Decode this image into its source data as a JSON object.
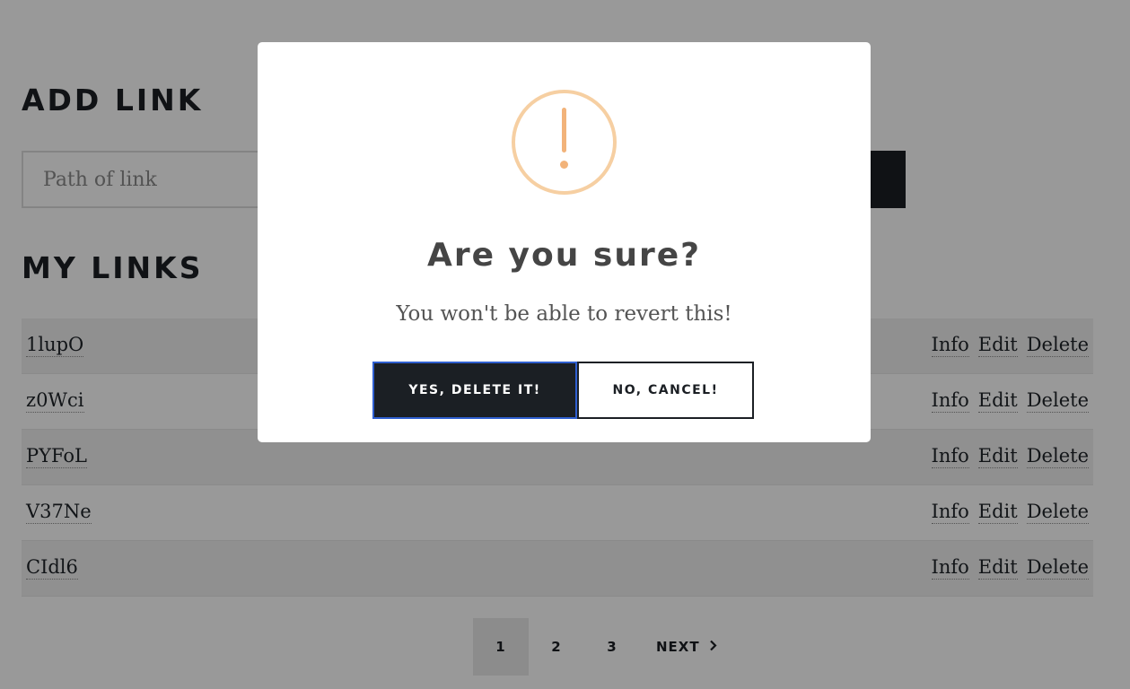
{
  "add_link": {
    "title": "ADD LINK",
    "input_placeholder": "Path of link"
  },
  "my_links": {
    "title": "MY LINKS",
    "items": [
      {
        "name": "1lupO"
      },
      {
        "name": "z0Wci"
      },
      {
        "name": "PYFoL"
      },
      {
        "name": "V37Ne"
      },
      {
        "name": "CIdl6"
      }
    ],
    "actions": {
      "info": "Info",
      "edit": "Edit",
      "delete": "Delete"
    }
  },
  "pagination": {
    "pages": [
      "1",
      "2",
      "3"
    ],
    "active": "1",
    "next_label": "NEXT",
    "next_icon": "chevron-right-icon"
  },
  "dialog": {
    "icon": "warning-icon",
    "icon_color": "#f8bb86",
    "title": "Are you sure?",
    "text": "You won't be able to revert this!",
    "confirm_label": "YES, DELETE IT!",
    "cancel_label": "NO, CANCEL!"
  }
}
